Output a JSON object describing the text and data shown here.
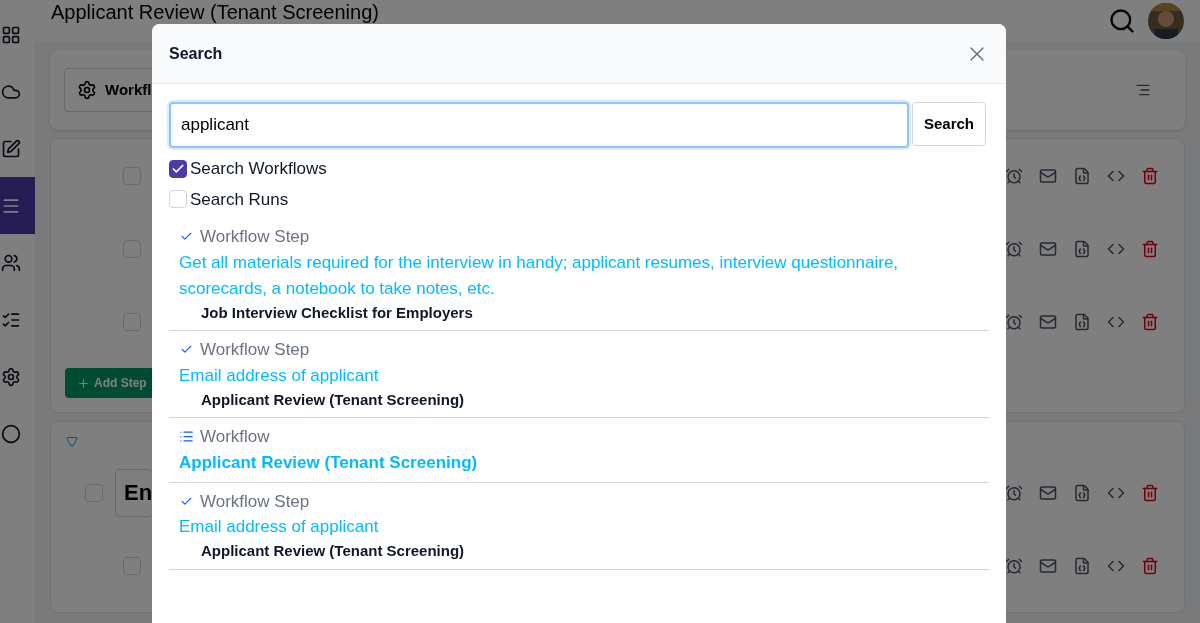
{
  "page": {
    "title": "Applicant Review (Tenant Screening)",
    "workflow_button": "Workfl",
    "add_step_button": "Add Step"
  },
  "sidebar": {
    "items": [
      {
        "kind": "grid",
        "selected": false
      },
      {
        "kind": "cloud",
        "selected": false
      },
      {
        "kind": "edit",
        "selected": false
      },
      {
        "kind": "list",
        "selected": true
      },
      {
        "kind": "users",
        "selected": false
      },
      {
        "kind": "check",
        "selected": false
      },
      {
        "kind": "settings",
        "selected": false
      },
      {
        "kind": "circle",
        "selected": false
      }
    ]
  },
  "cards": [
    {
      "rows": [
        {
          "checked": false
        },
        {
          "checked": false
        },
        {
          "checked": false
        }
      ]
    },
    {
      "expanded": true,
      "rows": [
        {
          "checked": false,
          "name": "En"
        },
        {
          "checked": false
        }
      ]
    }
  ],
  "dialog": {
    "title": "Search",
    "query": "applicant",
    "search_button": "Search",
    "options": [
      {
        "label": "Search Workflows",
        "checked": true
      },
      {
        "label": "Search Runs",
        "checked": false
      }
    ],
    "results": [
      {
        "kind": "step",
        "type": "Workflow Step",
        "title": "Get all materials required for the interview in handy; applicant resumes, interview questionnaire, scorecards, a notebook to take notes, etc.",
        "parent": "Job Interview Checklist for Employers"
      },
      {
        "kind": "step",
        "type": "Workflow Step",
        "title": "Email address of applicant",
        "parent": "Applicant Review (Tenant Screening)"
      },
      {
        "kind": "workflow",
        "type": "Workflow",
        "title": "Applicant Review (Tenant Screening)"
      },
      {
        "kind": "step",
        "type": "Workflow Step",
        "title": "Email address of applicant",
        "parent": "Applicant Review (Tenant Screening)"
      }
    ]
  }
}
